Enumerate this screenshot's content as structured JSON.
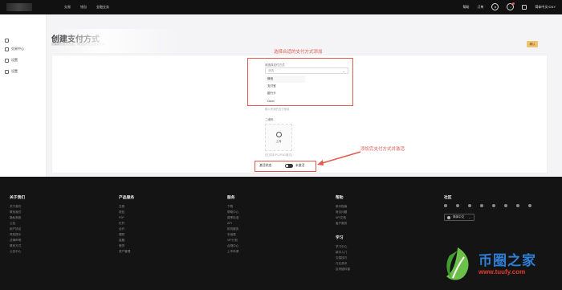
{
  "topbar": {
    "nav": [
      "交易",
      "钱包",
      "金融业务"
    ],
    "right": [
      "帮助",
      "订单",
      "简体中文/CNY"
    ],
    "icons": [
      "user-icon",
      "bell-icon",
      "grid-icon"
    ]
  },
  "sidebar": {
    "items": [
      "交易中心",
      "设置",
      "设置"
    ]
  },
  "page": {
    "title": "创建支付方式",
    "subtitle": "创建新的支付方式，添加后可在交易中使用",
    "top_button": "确认"
  },
  "annotations": {
    "select_hint": "选择合适的支付方式添加",
    "save_hint": "添加完支付方式并激活"
  },
  "form": {
    "method_label": "请选择支付方式",
    "method_placeholder": "请选",
    "options": [
      "微信",
      "支付宝",
      "银行卡",
      "Ozon"
    ],
    "note": "输入有效的支付信息",
    "qr_label": "二维码",
    "upload_label": "上传",
    "upload_hint": "(仅支持JPG/PNG格式)",
    "cancel_label": "激活状态",
    "activate_label": "未激活"
  },
  "footer": {
    "columns": [
      {
        "title": "关于我们",
        "links": [
          "关于我们",
          "联系我们",
          "隐私条款",
          "公告",
          "用户协议",
          "风险提示",
          "法律声明",
          "联系方式",
          "公告中心"
        ]
      },
      {
        "title": "产品服务",
        "links": [
          "交易",
          "钱包",
          "P2P",
          "杠杆",
          "合约",
          "理财",
          "金融",
          "借贷",
          "资产管理"
        ]
      },
      {
        "title": "服务",
        "links": [
          "下载",
          "帮助中心",
          "费率标准",
          "API",
          "机构服务",
          "手续费",
          "VIP计划",
          "合规中心",
          "上币申请"
        ]
      },
      {
        "title": "帮助",
        "links": [
          "新手指南",
          "常见问题",
          "API文档",
          "客户服务"
        ]
      }
    ],
    "social_title": "社区",
    "language": "简体中文",
    "learn": {
      "title": "学习",
      "links": [
        "学习中心",
        "新手入门",
        "交易技巧",
        "行业资讯",
        "区块链科普"
      ]
    }
  },
  "brand": {
    "name": "币圈之家",
    "url": "www.tuufy.com"
  }
}
